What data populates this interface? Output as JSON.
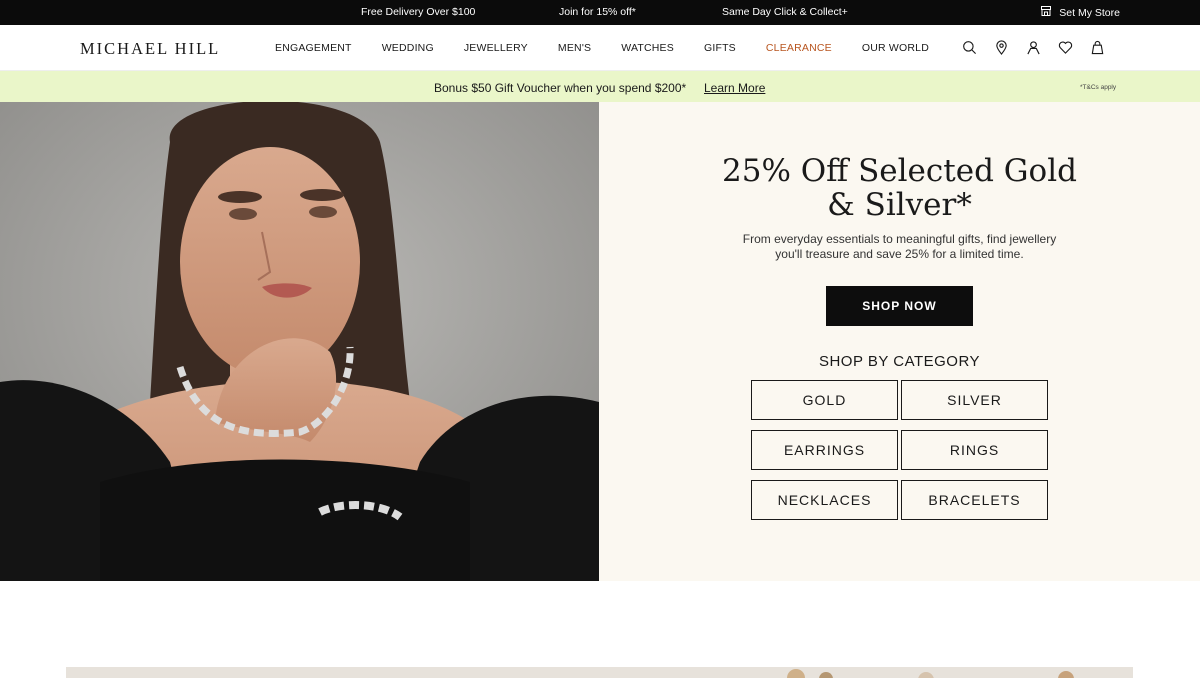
{
  "topbar": {
    "promo1": "Free Delivery Over $100",
    "promo2": "Join for 15% off*",
    "promo3": "Same Day Click & Collect+",
    "store_label": "Set My Store",
    "store_icon": "store-icon"
  },
  "header": {
    "logo": "MICHAEL HILL",
    "nav": [
      "ENGAGEMENT",
      "WEDDING",
      "JEWELLERY",
      "MEN'S",
      "WATCHES",
      "GIFTS",
      "CLEARANCE",
      "OUR WORLD"
    ],
    "icons": [
      "search-icon",
      "location-pin-icon",
      "account-icon",
      "wishlist-heart-icon",
      "shopping-bag-icon"
    ],
    "clearance_color": "#b8551f"
  },
  "bonus_bar": {
    "message": "Bonus $50 Gift Voucher when you spend $200*",
    "link": "Learn More",
    "terms": "*T&Cs apply",
    "background": "#eaf6c9"
  },
  "hero": {
    "title_line1": "25% Off Selected Gold",
    "title_line2": "& Silver*",
    "subtitle_line1": "From everyday essentials to meaningful gifts, find jewellery",
    "subtitle_line2": "you'll treasure and save 25% for a limited time.",
    "cta": "SHOP NOW",
    "category_heading": "SHOP BY CATEGORY",
    "categories": [
      "GOLD",
      "SILVER",
      "EARRINGS",
      "RINGS",
      "NECKLACES",
      "BRACELETS"
    ],
    "panel_background": "#fbf8f1"
  }
}
